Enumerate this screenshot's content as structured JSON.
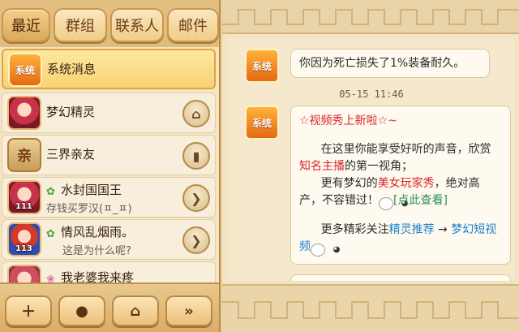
{
  "tabs": [
    {
      "label": "最近",
      "active": true
    },
    {
      "label": "群组",
      "active": false
    },
    {
      "label": "联系人",
      "active": false
    },
    {
      "label": "邮件",
      "active": false
    }
  ],
  "contacts": [
    {
      "name": "系统消息",
      "sub": "",
      "avatar_label": "系统",
      "selected": true
    },
    {
      "name": "梦幻精灵",
      "sub": "",
      "button_icon": "home-icon"
    },
    {
      "name": "三界亲友",
      "sub": "",
      "avatar_label": "亲",
      "button_icon": "book-icon"
    },
    {
      "name": "水封国国王",
      "sub": "存钱买罗汉(ㅍ_ㅍ)",
      "level": "111",
      "button_icon": "chevron-right-icon"
    },
    {
      "name": "情风乱烟雨。",
      "sub": "这是为什么呢?",
      "level": "113",
      "button_icon": "chevron-right-icon"
    },
    {
      "name": "我老婆我来疼",
      "sub": ""
    }
  ],
  "bottom_buttons": [
    "add-friend-icon",
    "chat-bubble-icon",
    "home-icon",
    "double-chevron-right-icon"
  ],
  "chat": {
    "sender_label": "系统",
    "message1": "你因为死亡损失了1%装备耐久。",
    "timestamp": "05-15 11:46",
    "message2": {
      "title": "☆视频秀上新啦☆~",
      "line1_a": "在这里你能享受好听的声音，欣赏",
      "line1_red": "知名主播",
      "line1_b": "的第一视角；",
      "line2_a": "更有梦幻的",
      "line2_red": "美女玩家秀",
      "line2_b": "，绝对高产，不容错过！",
      "link1": "[点此查看]",
      "line3_a": "更多精彩关注",
      "link_blue": "精灵推荐",
      "arrow": " → ",
      "link_green": "梦幻短视频"
    }
  },
  "colors": {
    "accent_orange": "#e46a12",
    "text_red": "#d7262a",
    "link_blue": "#1c7fc9",
    "link_green": "#2e8f55"
  }
}
